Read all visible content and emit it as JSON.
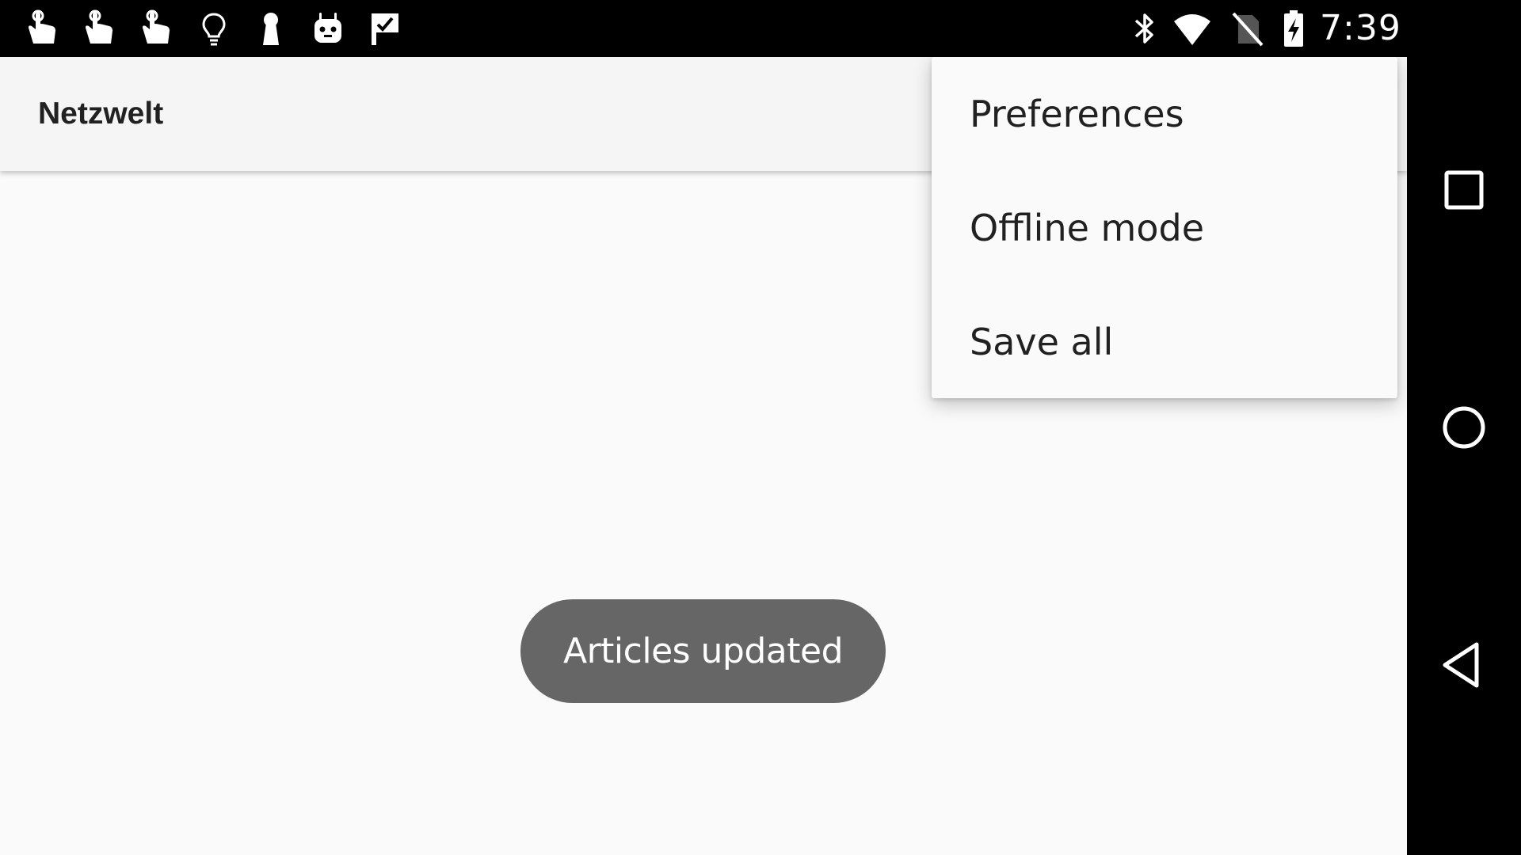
{
  "status_bar": {
    "time": "7:39",
    "notification_icons": [
      "touch-hand-icon",
      "touch-hand-icon",
      "touch-hand-icon",
      "lightbulb-icon",
      "keyhole-icon",
      "android-robot-icon",
      "checkmark-flag-icon"
    ],
    "system_icons": [
      "bluetooth-icon",
      "wifi-icon",
      "no-sim-icon",
      "battery-charging-icon"
    ]
  },
  "app_bar": {
    "title": "Netzwelt"
  },
  "overflow_menu": {
    "items": [
      {
        "label": "Preferences"
      },
      {
        "label": "Offline mode"
      },
      {
        "label": "Save all"
      }
    ]
  },
  "toast": {
    "message": "Articles updated"
  },
  "nav_bar": {
    "buttons": [
      "recents-square-icon",
      "home-circle-icon",
      "back-triangle-icon"
    ]
  },
  "colors": {
    "status_bar": "#000000",
    "app_bar": "#f5f5f5",
    "content_bg": "#fafafa",
    "toast_bg": "#666666",
    "text_primary": "#212121"
  }
}
